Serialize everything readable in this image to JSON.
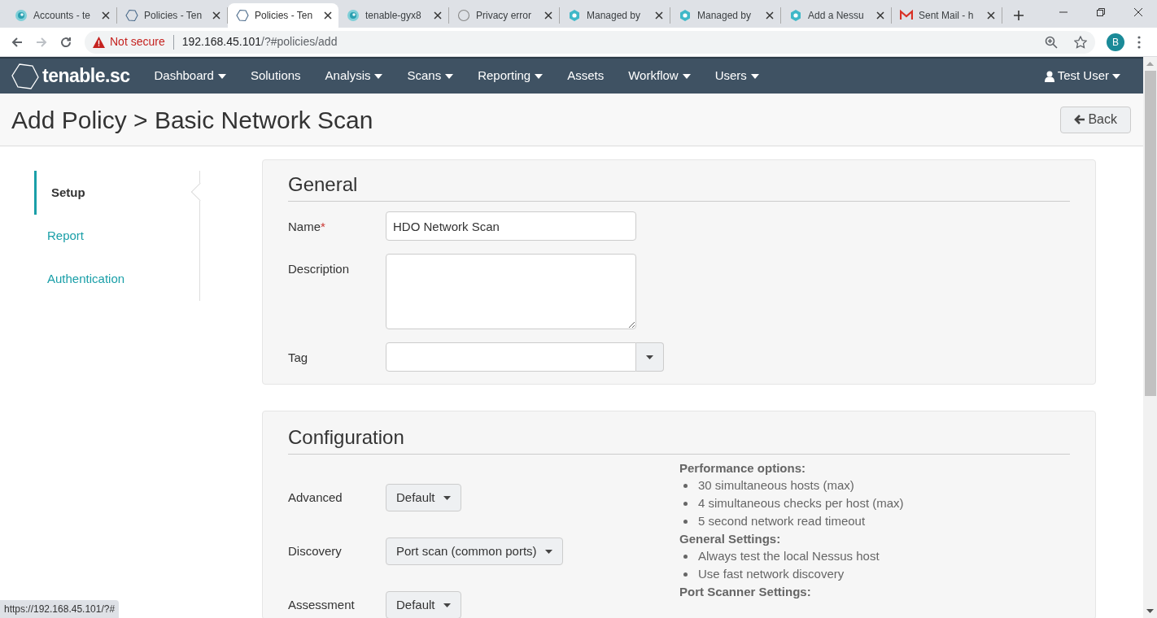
{
  "browser": {
    "tabs": [
      {
        "title": "Accounts - te",
        "kind": "swirl",
        "selected": false
      },
      {
        "title": "Policies - Ten",
        "kind": "outline",
        "selected": false
      },
      {
        "title": "Policies - Ten",
        "kind": "outline",
        "selected": true
      },
      {
        "title": "tenable-gyx8",
        "kind": "swirl",
        "selected": false
      },
      {
        "title": "Privacy error",
        "kind": "grey",
        "selected": false
      },
      {
        "title": "Managed by",
        "kind": "ring",
        "selected": false
      },
      {
        "title": "Managed by",
        "kind": "ring",
        "selected": false
      },
      {
        "title": "Add a Nessu",
        "kind": "ring",
        "selected": false
      },
      {
        "title": "Sent Mail - h",
        "kind": "mail",
        "selected": false
      }
    ],
    "address": {
      "warning": "Not secure",
      "host": "192.168.45.101",
      "path": "/?#policies/add"
    },
    "profile": "B"
  },
  "nav": {
    "logo": "tenable.sc",
    "items": [
      {
        "label": "Dashboard",
        "dropdown": true
      },
      {
        "label": "Solutions",
        "dropdown": false
      },
      {
        "label": "Analysis",
        "dropdown": true
      },
      {
        "label": "Scans",
        "dropdown": true
      },
      {
        "label": "Reporting",
        "dropdown": true
      },
      {
        "label": "Assets",
        "dropdown": false
      },
      {
        "label": "Workflow",
        "dropdown": true
      },
      {
        "label": "Users",
        "dropdown": true
      }
    ],
    "user": "Test User"
  },
  "page": {
    "title": "Add Policy > Basic Network Scan",
    "back": "Back"
  },
  "side_nav": [
    {
      "label": "Setup",
      "selected": true
    },
    {
      "label": "Report",
      "selected": false
    },
    {
      "label": "Authentication",
      "selected": false
    }
  ],
  "general": {
    "heading": "General",
    "fields": [
      {
        "kind": "text",
        "label": "Name",
        "required_mark": "*",
        "value": "HDO Network Scan"
      },
      {
        "kind": "textarea",
        "label": "Description"
      },
      {
        "kind": "tag",
        "label": "Tag"
      }
    ]
  },
  "configuration": {
    "heading": "Configuration",
    "selects": [
      {
        "label": "Advanced",
        "value": "Default"
      },
      {
        "label": "Discovery",
        "value": "Port scan (common ports)"
      },
      {
        "label": "Assessment",
        "value": "Default"
      }
    ],
    "summary": [
      {
        "heading": "Performance options:",
        "items": [
          "30 simultaneous hosts (max)",
          "4 simultaneous checks per host (max)",
          "5 second network read timeout"
        ]
      },
      {
        "heading": "General Settings:",
        "items": [
          "Always test the local Nessus host",
          "Use fast network discovery"
        ]
      },
      {
        "heading": "Port Scanner Settings:"
      }
    ]
  },
  "status_url": "https://192.168.45.101/?#"
}
